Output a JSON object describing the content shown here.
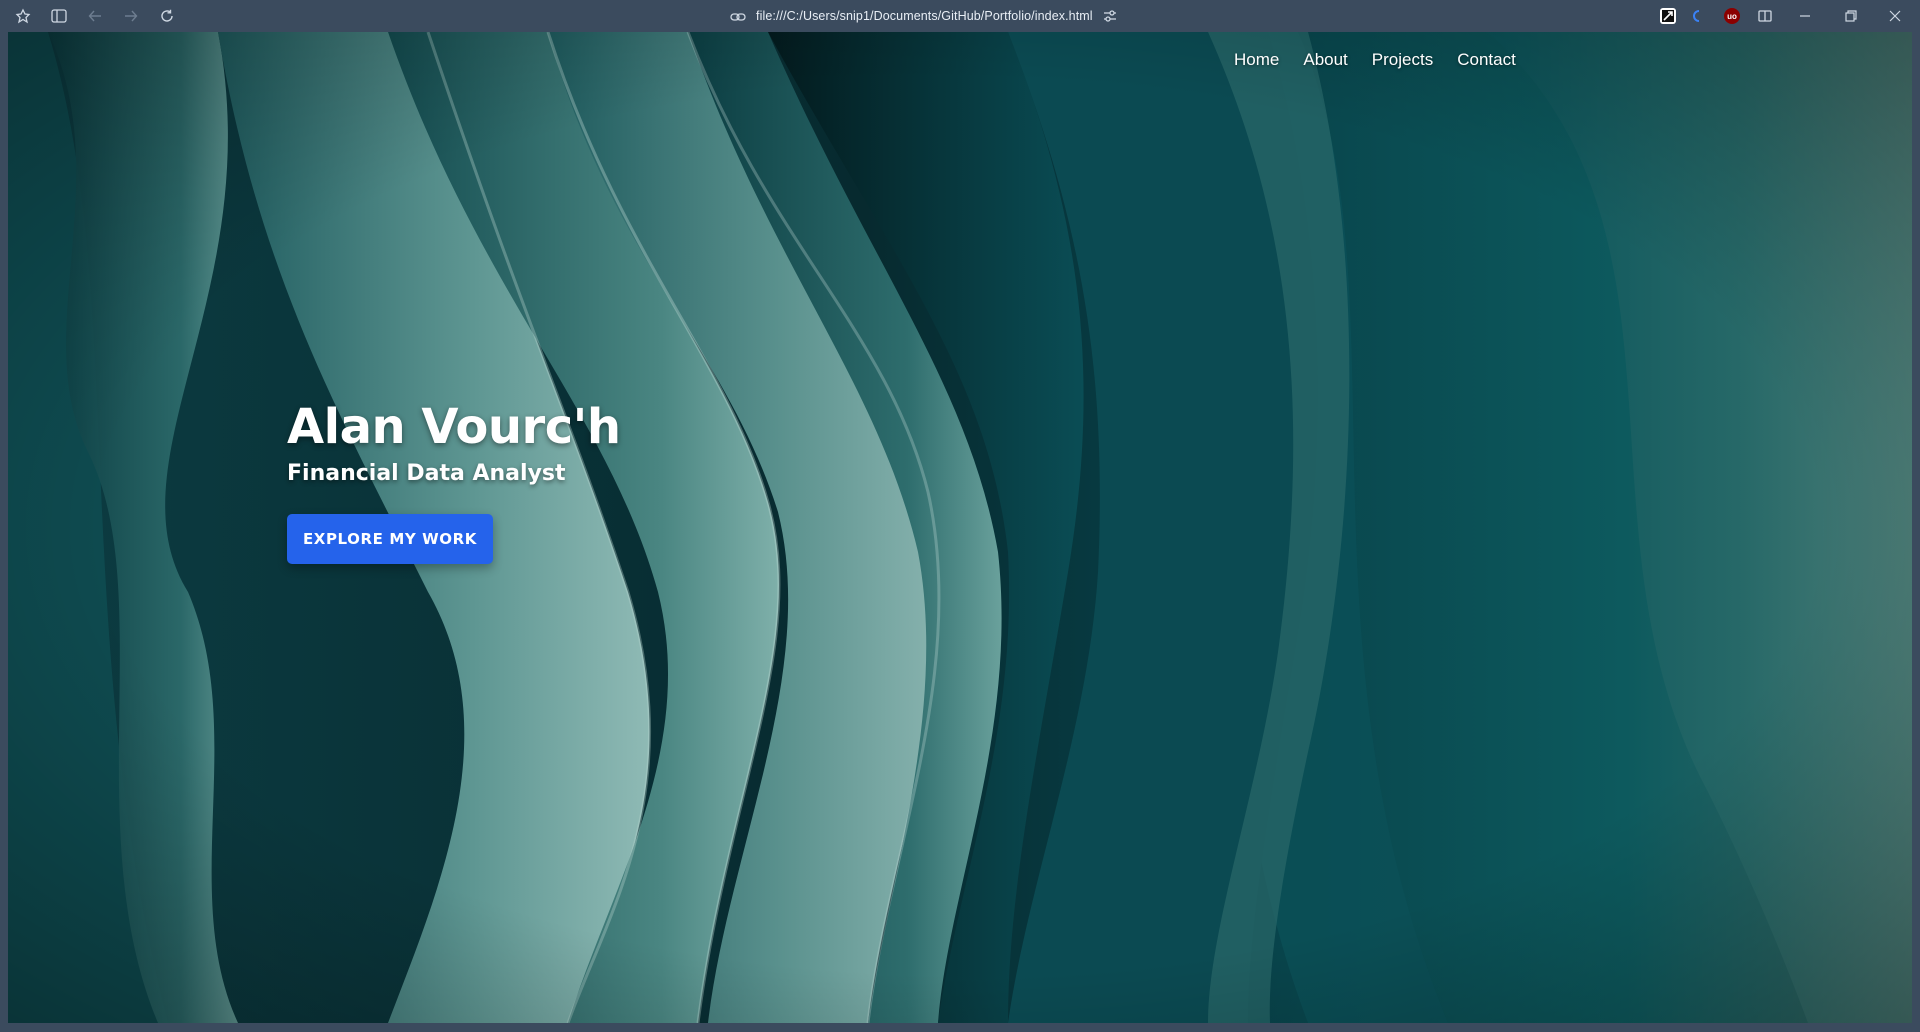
{
  "browser": {
    "url": "file:///C:/Users/snip1/Documents/GitHub/Portfolio/index.html",
    "icons": {
      "workspaces": "workspaces-icon",
      "sidebar": "sidebar-toggle-icon",
      "back": "back-arrow-icon",
      "forward": "forward-arrow-icon",
      "reload": "reload-icon",
      "site_info": "link-icon",
      "tune": "tune-icon",
      "split_view": "split-view-icon",
      "minimize": "minimize-icon",
      "restore": "restore-icon",
      "close": "close-icon"
    },
    "extensions": [
      {
        "name": "extension-1",
        "label": ""
      },
      {
        "name": "extension-2",
        "label": ""
      },
      {
        "name": "ublock-extension",
        "label": "uo"
      }
    ]
  },
  "page": {
    "nav": [
      "Home",
      "About",
      "Projects",
      "Contact"
    ],
    "hero": {
      "name": "Alan Vourc'h",
      "title": "Financial Data Analyst",
      "cta": "EXPLORE MY WORK"
    },
    "colors": {
      "accent": "#2563eb",
      "background_teal": "#0b3f46",
      "chrome": "#3b4b5e"
    }
  }
}
